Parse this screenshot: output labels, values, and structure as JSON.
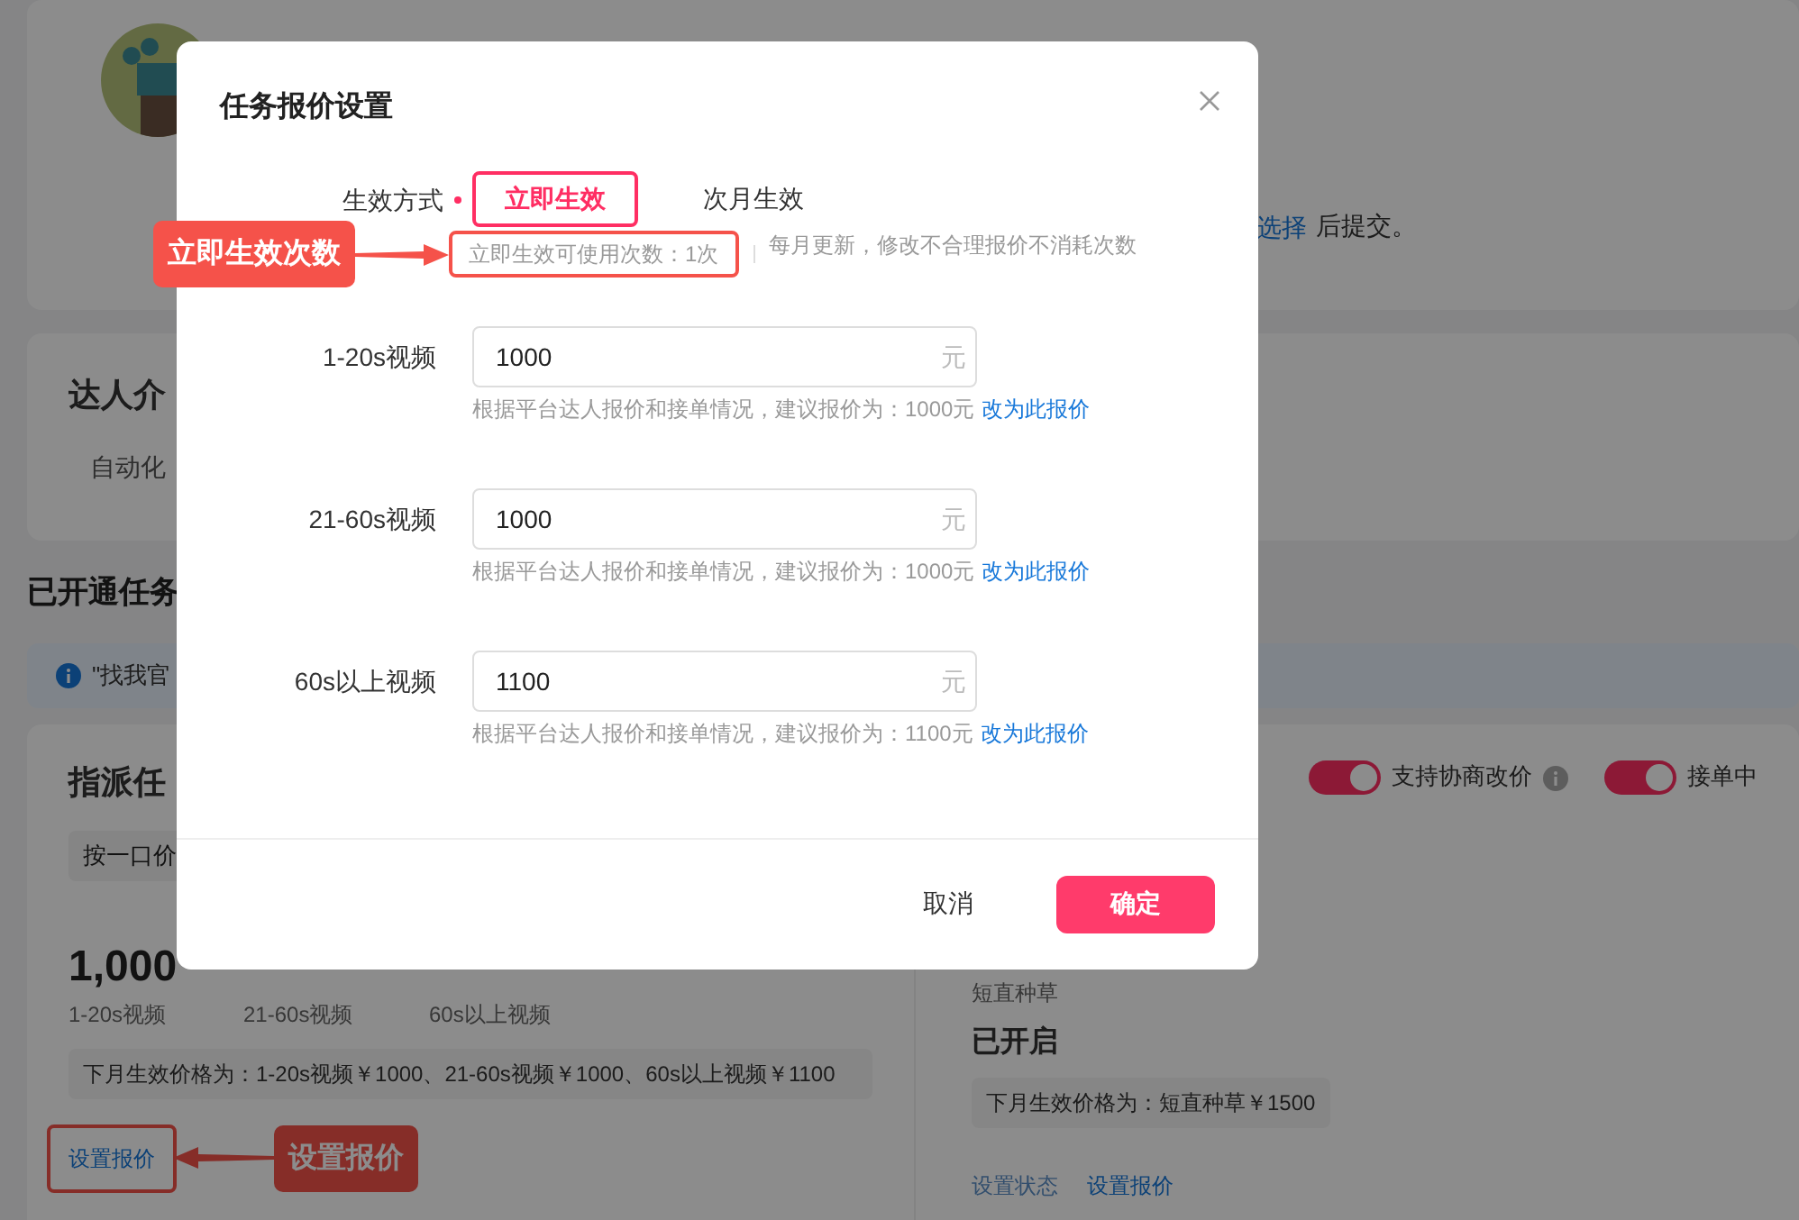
{
  "profile": {
    "notice_link": "选择",
    "notice_text": "后提交。"
  },
  "intro": {
    "title": "达人介",
    "text": "自动化"
  },
  "tasks_heading": "已开通任务",
  "info_banner": "\"找我官",
  "assign_card": {
    "title": "指派任",
    "pricing_chip": "按一口价",
    "price": "1,000",
    "price_labels": [
      "1-20s视频",
      "21-60s视频",
      "60s以上视频"
    ],
    "next_month": "下月生效价格为：1-20s视频￥1000、21-60s视频￥1000、60s以上视频￥1100",
    "link": "设置报价",
    "link_highlighted": true,
    "callout": "设置报价"
  },
  "right_card": {
    "toggles": [
      {
        "label": "支持协商改价",
        "on": true,
        "info": true
      },
      {
        "label": "接单中",
        "on": true,
        "info": false
      }
    ],
    "category": "短直种草",
    "status": "已开启",
    "next_month": "下月生效价格为：短直种草￥1500",
    "links": [
      "设置状态",
      "设置报价"
    ]
  },
  "modal": {
    "title": "任务报价设置",
    "mode": {
      "label": "生效方式",
      "required": true,
      "options": [
        {
          "label": "立即生效",
          "selected": true
        },
        {
          "label": "次月生效",
          "selected": false
        }
      ],
      "count_hint": "立即生效可使用次数：1次",
      "count_highlighted": true,
      "callout": "立即生效次数",
      "hint": "每月更新，修改不合理报价不消耗次数"
    },
    "fields": [
      {
        "label": "1-20s视频",
        "value": "1000",
        "unit": "元",
        "hint": "根据平台达人报价和接单情况，建议报价为：1000元",
        "link": "改为此报价"
      },
      {
        "label": "21-60s视频",
        "value": "1000",
        "unit": "元",
        "hint": "根据平台达人报价和接单情况，建议报价为：1000元",
        "link": "改为此报价"
      },
      {
        "label": "60s以上视频",
        "value": "1100",
        "unit": "元",
        "hint": "根据平台达人报价和接单情况，建议报价为：1100元",
        "link": "改为此报价"
      }
    ],
    "buttons": [
      {
        "label": "取消",
        "kind": "secondary"
      },
      {
        "label": "确定",
        "kind": "primary"
      }
    ]
  }
}
